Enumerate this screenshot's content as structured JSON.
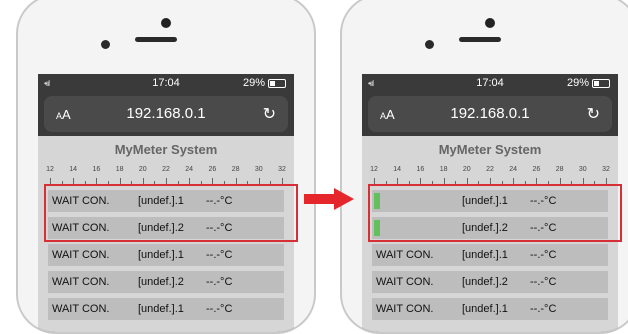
{
  "status": {
    "signal": "•ııl",
    "time": "17:04",
    "battery": "29%"
  },
  "browser": {
    "text_size_small": "A",
    "text_size_large": "A",
    "url": "192.168.0.1",
    "reload": "↻"
  },
  "app": {
    "title": "MyMeter System"
  },
  "scale_ticks": [
    "12",
    "14",
    "16",
    "18",
    "20",
    "22",
    "24",
    "26",
    "28",
    "30",
    "32"
  ],
  "left_rows": [
    {
      "name": "WAIT CON.",
      "undef": "[undef.].1",
      "temp": "--.-°C"
    },
    {
      "name": "WAIT CON.",
      "undef": "[undef.].2",
      "temp": "--.-°C"
    },
    {
      "name": "WAIT CON.",
      "undef": "[undef.].1",
      "temp": "--.-°C"
    },
    {
      "name": "WAIT CON.",
      "undef": "[undef.].2",
      "temp": "--.-°C"
    },
    {
      "name": "WAIT CON.",
      "undef": "[undef.].1",
      "temp": "--.-°C"
    }
  ],
  "right_rows": [
    {
      "name": "",
      "undef": "[undef.].1",
      "temp": "--.-°C",
      "status_bar": true
    },
    {
      "name": "",
      "undef": "[undef.].2",
      "temp": "--.-°C",
      "status_bar": true
    },
    {
      "name": "WAIT CON.",
      "undef": "[undef.].1",
      "temp": "--.-°C"
    },
    {
      "name": "WAIT CON.",
      "undef": "[undef.].2",
      "temp": "--.-°C"
    },
    {
      "name": "WAIT CON.",
      "undef": "[undef.].1",
      "temp": "--.-°C"
    }
  ],
  "colors": {
    "highlight": "#d62f35",
    "status_green": "#63c05d"
  }
}
